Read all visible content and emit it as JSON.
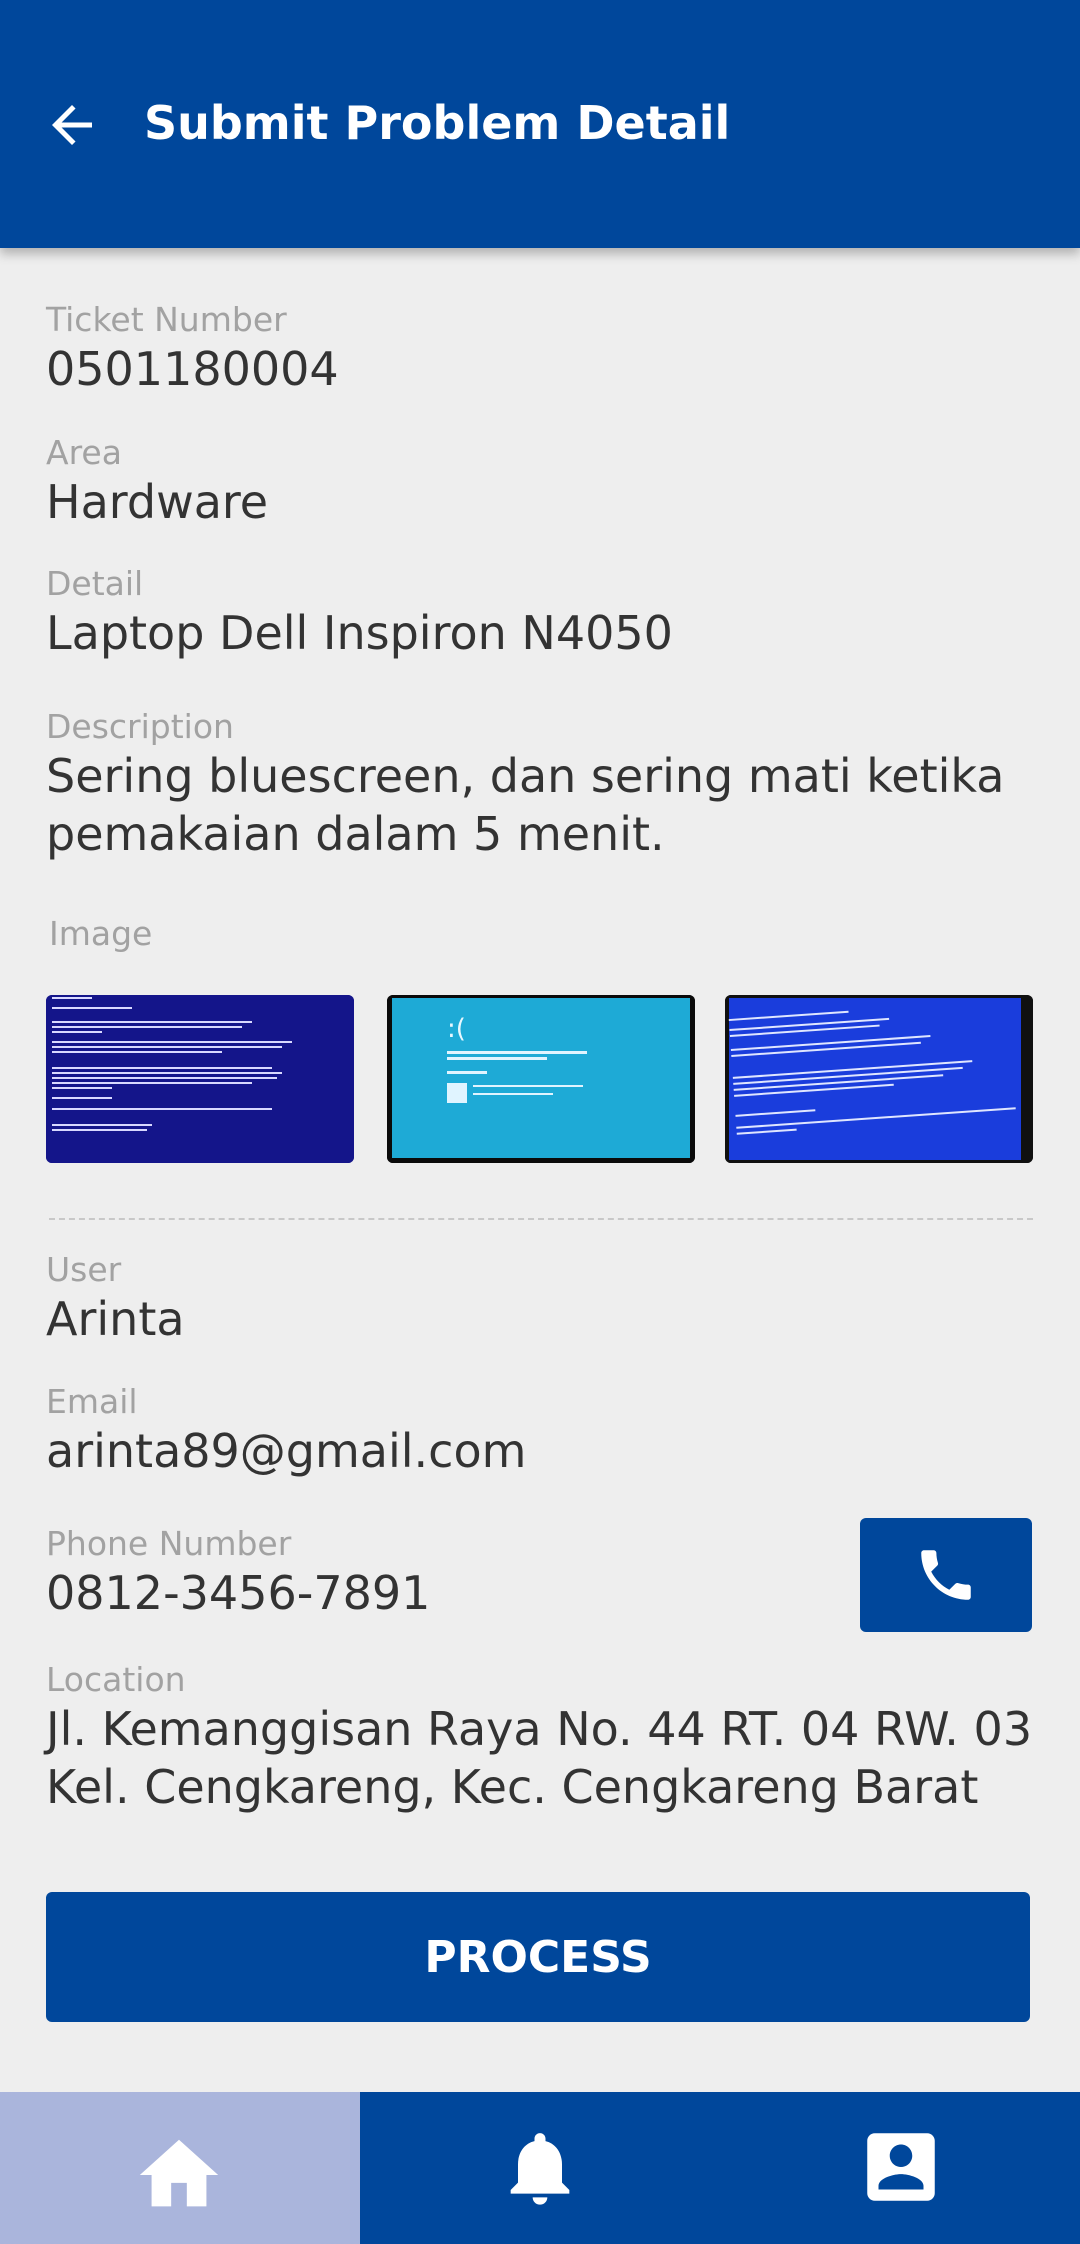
{
  "header": {
    "title": "Submit Problem Detail",
    "back_icon": "arrow-back-icon"
  },
  "ticket": {
    "ticket_number_label": "Ticket Number",
    "ticket_number": "0501180004",
    "area_label": "Area",
    "area": "Hardware",
    "detail_label": "Detail",
    "detail": "Laptop Dell Inspiron N4050",
    "description_label": "Description",
    "description": "Sering bluescreen, dan sering mati ketika pemakaian dalam 5 menit.",
    "image_label": "Image"
  },
  "user": {
    "user_label": "User",
    "user": "Arinta",
    "email_label": "Email",
    "email": "arinta89@gmail.com",
    "phone_label": "Phone Number",
    "phone": "0812-3456-7891",
    "location_label": "Location",
    "location_line1": "Jl. Kemanggisan Raya No. 44 RT. 04 RW. 03",
    "location_line2": "Kel. Cengkareng, Kec. Cengkareng Barat"
  },
  "actions": {
    "process_label": "PROCESS",
    "call_icon": "phone-icon"
  },
  "bottom_nav": [
    {
      "icon": "home-icon",
      "active": true
    },
    {
      "icon": "bell-icon",
      "active": false
    },
    {
      "icon": "profile-icon",
      "active": false
    }
  ],
  "colors": {
    "primary": "#00479b",
    "nav_active": "#aab5dc",
    "background": "#eeeeee"
  }
}
